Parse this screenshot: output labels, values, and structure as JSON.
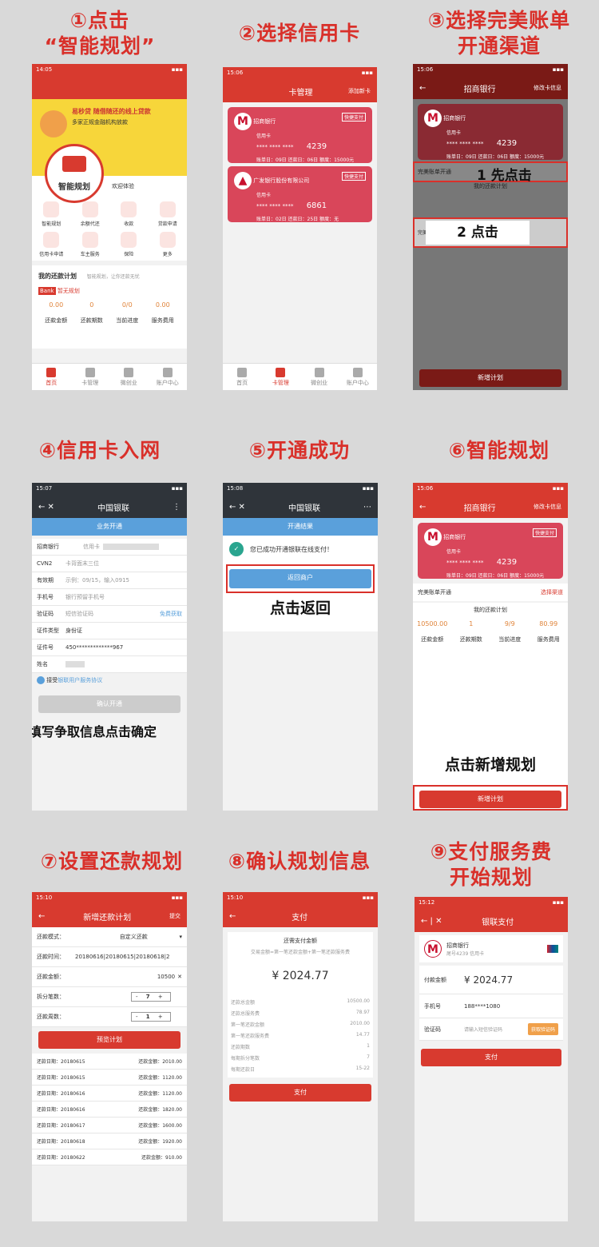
{
  "captions": {
    "c1a": "①点击",
    "c1b": "“智能规划”",
    "c2": "②选择信用卡",
    "c3a": "③选择完美账单",
    "c3b": "开通渠道",
    "c4": "④信用卡入网",
    "c5": "⑤开通成功",
    "c6": "⑥智能规划",
    "c7": "⑦设置还款规划",
    "c8": "⑧确认规划信息",
    "c9a": "⑨支付服务费",
    "c9b": "开始规划"
  },
  "p1": {
    "time": "14:05",
    "banner_title": "易秒贷 随借随还的线上贷款",
    "banner_sub": "多家正规金融机构放款",
    "bubble": "智能规划",
    "welcome": "欢迎体验",
    "grid": [
      "智能规划",
      "余额代还",
      "收款",
      "贷款申请",
      "信用卡申请",
      "车主服务",
      "保险",
      "更多"
    ],
    "plan_title": "我的还款计划",
    "plan_hint": "智能规划，让你还款无忧",
    "bank": "Bank",
    "bank_label": "暂无规划",
    "stats": [
      {
        "v": "0.00",
        "l": "还款金额"
      },
      {
        "v": "0",
        "l": "还款期数"
      },
      {
        "v": "0/0",
        "l": "当前进度"
      },
      {
        "v": "0.00",
        "l": "服务费用"
      }
    ],
    "tabs": [
      "首页",
      "卡管理",
      "微创业",
      "账户中心"
    ]
  },
  "p2": {
    "time": "15:06",
    "title": "卡管理",
    "action": "添加新卡",
    "cards": [
      {
        "bank": "招商银行",
        "type": "信用卡",
        "tail": "4239",
        "badge": "快捷支付",
        "info": "账单日：09日  还款日：06日  额度：15000元"
      },
      {
        "bank": "广发银行股份有限公司",
        "type": "信用卡",
        "tail": "6861",
        "badge": "快捷支付",
        "info": "账单日：02日  还款日：25日  额度：无"
      }
    ],
    "tabs": [
      "首页",
      "卡管理",
      "微创业",
      "账户中心"
    ]
  },
  "p3": {
    "time": "15:06",
    "title": "招商银行",
    "action": "修改卡信息",
    "bank": "招商银行",
    "type": "信用卡",
    "tail": "4239",
    "info": "账单日：09日  还款日：06日  额度：15000元",
    "channel": "完美账单开通",
    "plan": "我的还款计划",
    "option": "完美账单渠道4",
    "note1": "1 先点击",
    "note2": "2 点击",
    "btn": "新增计划"
  },
  "p4": {
    "time": "15:07",
    "title": "中国银联",
    "sub": "业务开通",
    "rows": [
      {
        "k": "招商银行",
        "v": "信用卡"
      },
      {
        "k": "CVN2",
        "v": "卡背面末三位"
      },
      {
        "k": "有效期",
        "v": "示例：09/15，输入0915"
      },
      {
        "k": "手机号",
        "v": "银行预留手机号"
      },
      {
        "k": "验证码",
        "v": "短信验证码",
        "extra": "免费获取"
      },
      {
        "k": "证件类型",
        "v": "身份证"
      },
      {
        "k": "证件号",
        "v": "450*************967"
      },
      {
        "k": "姓名",
        "v": ""
      }
    ],
    "agree": "接受",
    "agree_link": "银联用户服务协议",
    "btn": "确认开通",
    "note": "填写争取信息点击确定"
  },
  "p5": {
    "time": "15:08",
    "title": "中国银联",
    "sub": "开通结果",
    "success": "您已成功开通银联在线支付！",
    "btn": "返回商户",
    "note": "点击返回"
  },
  "p6": {
    "time": "15:06",
    "title": "招商银行",
    "action": "修改卡信息",
    "bank": "招商银行",
    "type": "信用卡",
    "tail": "4239",
    "badge": "快捷支付",
    "info": "账单日：09日  还款日：06日  额度：15000元",
    "channel": "完美账单开通",
    "channel_action": "选择渠道",
    "plan": "我的还款计划",
    "stats": [
      {
        "v": "10500.00",
        "l": "还款金额"
      },
      {
        "v": "1",
        "l": "还款期数"
      },
      {
        "v": "9/9",
        "l": "当前进度"
      },
      {
        "v": "80.99",
        "l": "服务费用"
      }
    ],
    "note": "点击新增规划",
    "btn": "新增计划"
  },
  "p7": {
    "time": "15:10",
    "title": "新增还款计划",
    "action": "提交",
    "rows": [
      {
        "k": "还款模式：",
        "v": "自定义还款"
      },
      {
        "k": "还款时间：",
        "v": "20180616|20180615|20180618|2"
      },
      {
        "k": "还款金额：",
        "v": "10500"
      },
      {
        "k": "拆分笔数：",
        "v": "7"
      },
      {
        "k": "还款周数：",
        "v": "1"
      }
    ],
    "btn": "预览计划",
    "list": [
      {
        "d": "还款日期：20180615",
        "a": "还款金额：2010.00"
      },
      {
        "d": "还款日期：20180615",
        "a": "还款金额：1120.00"
      },
      {
        "d": "还款日期：20180616",
        "a": "还款金额：1120.00"
      },
      {
        "d": "还款日期：20180616",
        "a": "还款金额：1820.00"
      },
      {
        "d": "还款日期：20180617",
        "a": "还款金额：1600.00"
      },
      {
        "d": "还款日期：20180618",
        "a": "还款金额：1920.00"
      },
      {
        "d": "还款日期：20180622",
        "a": "还款金额：910.00"
      }
    ]
  },
  "p8": {
    "time": "15:10",
    "title": "支付",
    "head": "还需支付金额",
    "sub": "交易金额=第一笔还款金额+第一笔还款服务费",
    "amount": "¥ 2024.77",
    "rows": [
      {
        "k": "还款总金额",
        "v": "10500.00"
      },
      {
        "k": "还款总服务费",
        "v": "78.97"
      },
      {
        "k": "第一笔还款金额",
        "v": "2010.00"
      },
      {
        "k": "第一笔还款服务费",
        "v": "14.77"
      },
      {
        "k": "还款期数",
        "v": "1"
      },
      {
        "k": "每期拆分笔数",
        "v": "7"
      },
      {
        "k": "每期还款日",
        "v": "15-22"
      }
    ],
    "btn": "支付"
  },
  "p9": {
    "time": "15:12",
    "title": "银联支付",
    "bank": "招商银行",
    "card": "尾号4239 信用卡",
    "amount_label": "付款金额",
    "amount": "¥ 2024.77",
    "phone_label": "手机号",
    "phone": "188****1080",
    "code_label": "验证码",
    "code_ph": "请输入短信验证码",
    "code_btn": "获取验证码",
    "btn": "支付"
  }
}
